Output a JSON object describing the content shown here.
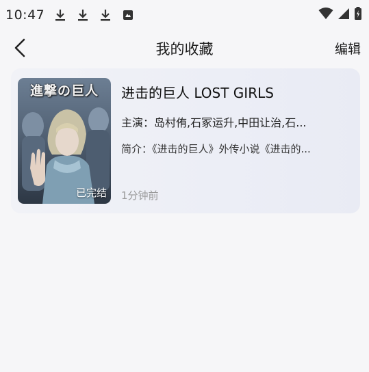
{
  "status_bar": {
    "time": "10:47",
    "icons_left": [
      "download-icon",
      "download-icon",
      "download-icon",
      "notification-box-icon"
    ],
    "icons_right": [
      "wifi-icon",
      "signal-icon",
      "battery-icon"
    ]
  },
  "nav": {
    "back_icon": "back-chevron-icon",
    "title": "我的收藏",
    "edit_label": "编辑"
  },
  "favorites": [
    {
      "title": "进击的巨人 LOST GIRLS",
      "actors": "主演：岛村侑,石冢运升,中田让治,石...",
      "intro": "简介：《进击的巨人》外传小说《进击的...",
      "cover_logo_text": "進撃の巨人",
      "badge": "已完结",
      "time_ago": "1分钟前"
    }
  ]
}
